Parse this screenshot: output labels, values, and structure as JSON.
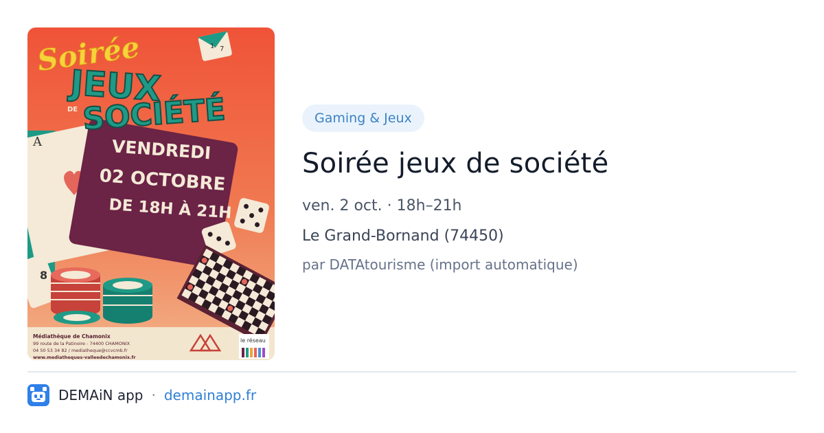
{
  "event": {
    "category": "Gaming & Jeux",
    "title": "Soirée jeux de société",
    "schedule": "ven. 2 oct. · 18h–21h",
    "location": "Le Grand-Bornand (74450)",
    "source": "par DATAtourisme (import automatique)"
  },
  "poster": {
    "script_title": "Soirée",
    "title_line1": "JEUX",
    "title_de": "DE",
    "title_line2": "SOCIÉTÉ",
    "date_line1": "VENDREDI",
    "date_line2": "02 OCTOBRE",
    "date_line3": "DE 18H À 21H",
    "venue": "Médiathèque de Chamonix",
    "address": "99 route de la Patinoire - 74400 CHAMONIX",
    "contact": "04 50 53 34 82 / mediatheque@ccvcmb.fr",
    "website": "www.mediatheques-valleedechamonix.fr",
    "card_letter": "A",
    "card_number": "8",
    "die_1": "1",
    "die_7": "7",
    "partner_logo": "le réseau",
    "colors": {
      "background_top": "#ef5a3c",
      "background_bottom": "#f0b07a",
      "title_teal": "#1f9a86",
      "script_yellow": "#f6d33a",
      "date_card": "#6b2346"
    }
  },
  "footer": {
    "app_name": "DEMAiN app",
    "separator": "·",
    "domain": "demainapp.fr",
    "app_icon": "demain-app-icon"
  }
}
